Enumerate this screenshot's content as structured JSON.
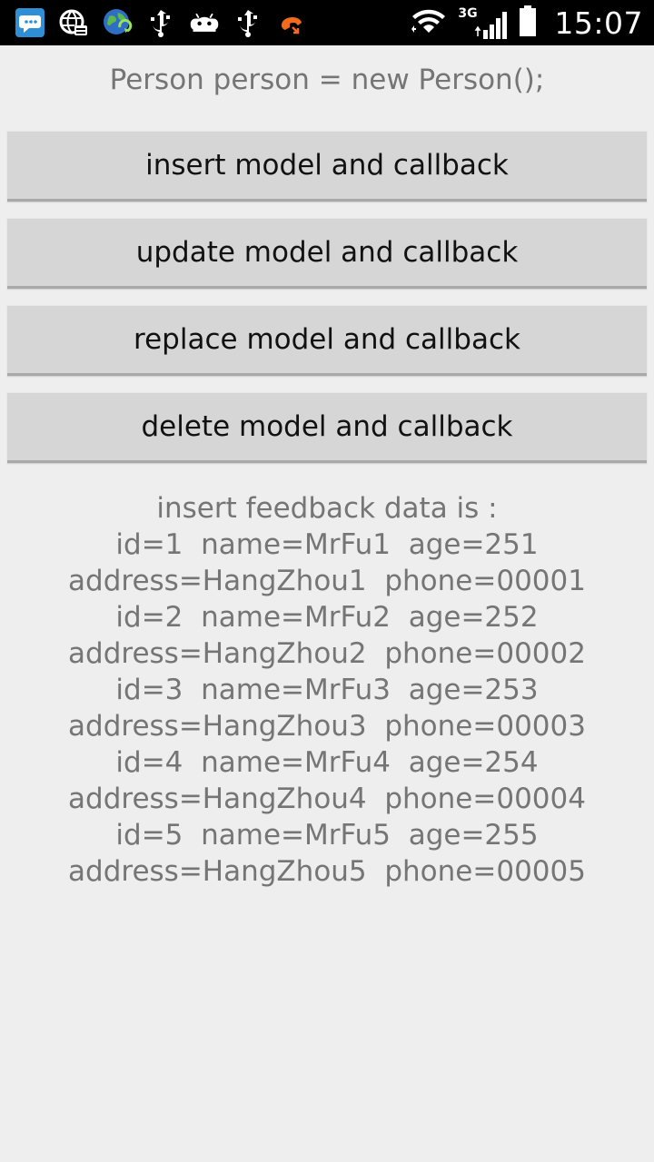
{
  "status_bar": {
    "time": "15:07",
    "network": "3G",
    "icons": [
      "chat-icon",
      "browser-icon",
      "globe-sync-icon",
      "usb-icon",
      "android-icon",
      "usb-icon",
      "missed-call-icon",
      "wifi-icon",
      "signal-icon",
      "battery-icon"
    ]
  },
  "heading": "Person person = new Person();",
  "buttons": {
    "insert": "insert model and callback",
    "update": "update model and callback",
    "replace": "replace model and callback",
    "delete": "delete model and callback"
  },
  "feedback": {
    "title": "insert feedback data is :",
    "lines": [
      "id=1  name=MrFu1  age=251",
      "address=HangZhou1  phone=00001",
      "id=2  name=MrFu2  age=252",
      "address=HangZhou2  phone=00002",
      "id=3  name=MrFu3  age=253",
      "address=HangZhou3  phone=00003",
      "id=4  name=MrFu4  age=254",
      "address=HangZhou4  phone=00004",
      "id=5  name=MrFu5  age=255",
      "address=HangZhou5  phone=00005"
    ]
  },
  "colors": {
    "background": "#eeeeee",
    "button": "#d6d6d6",
    "text_gray": "#757575",
    "missed_call": "#f26a1b"
  }
}
